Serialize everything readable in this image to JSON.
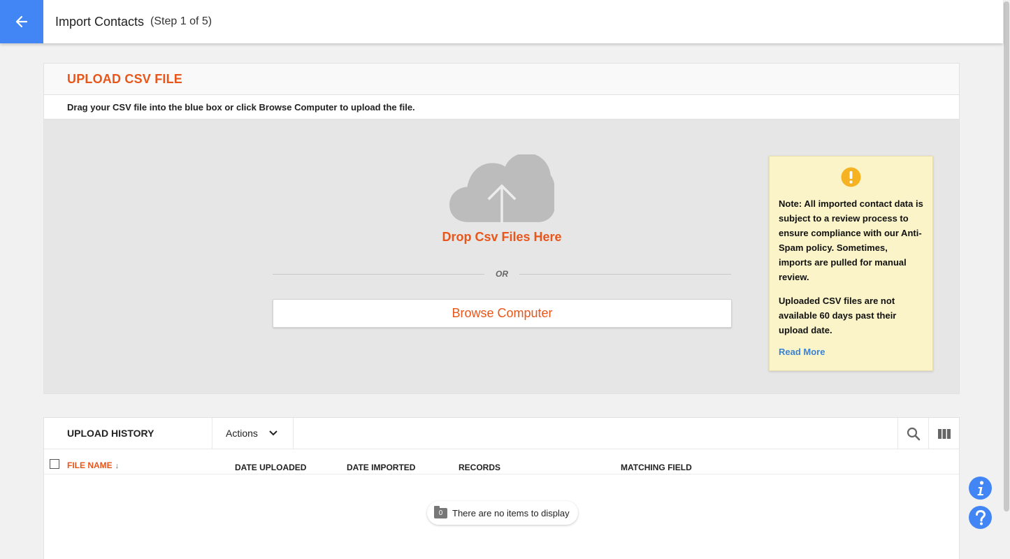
{
  "header": {
    "title": "Import Contacts",
    "step": "(Step 1 of 5)"
  },
  "upload": {
    "title": "UPLOAD CSV FILE",
    "instructions": "Drag your CSV file into the blue box or click Browse Computer to upload the file.",
    "drop_text": "Drop Csv Files Here",
    "or_text": "OR",
    "browse_label": "Browse Computer"
  },
  "note": {
    "paragraph1": "Note: All imported contact data is subject to a review process to ensure compliance with our Anti-Spam policy. Sometimes, imports are pulled for manual review.",
    "paragraph2": "Uploaded CSV files are not available 60 days past their upload date.",
    "link": "Read More"
  },
  "history": {
    "title": "UPLOAD HISTORY",
    "actions_label": "Actions",
    "columns": {
      "file_name": "FILE NAME",
      "sort_indicator": "↓",
      "date_uploaded": "DATE UPLOADED",
      "date_imported": "DATE IMPORTED",
      "records": "RECORDS",
      "matching_field": "MATCHING FIELD"
    },
    "empty": {
      "count": "0",
      "message": "There are no items to display"
    }
  },
  "floating": {
    "info_glyph": "i",
    "help_glyph": "?"
  },
  "colors": {
    "accent_orange": "#e8561b",
    "primary_blue": "#4285f4",
    "note_background": "#faf4c8",
    "warning_yellow": "#f5b323"
  }
}
